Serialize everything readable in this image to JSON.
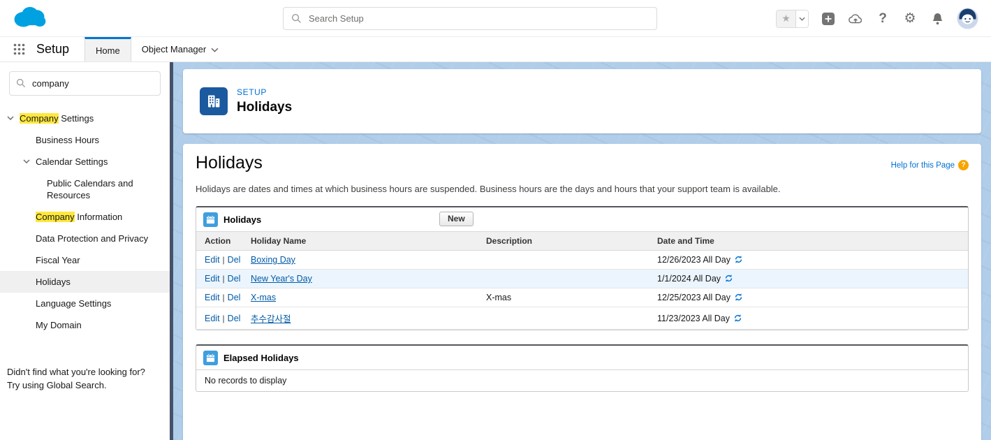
{
  "colors": {
    "brand_blue": "#00a1e0",
    "accent_blue": "#0176d3",
    "link_blue": "#015ba7",
    "content_background": "#b0cde9",
    "search_highlight": "#ffe83d",
    "setup_icon_blue": "#1b5a9e",
    "list_icon_blue": "#3f9ede",
    "help_icon_orange": "#f7a400"
  },
  "header": {
    "search": {
      "placeholder": "Search Setup"
    },
    "icons": [
      "favorites-star",
      "favorites-dropdown",
      "global-actions-plus",
      "upload-cloud",
      "help-question",
      "setup-gear",
      "notifications-bell",
      "user-avatar"
    ]
  },
  "nav": {
    "app_label": "Setup",
    "tabs": [
      {
        "label": "Home"
      },
      {
        "label": "Object Manager"
      }
    ]
  },
  "sidebar": {
    "search_value": "company",
    "items": [
      {
        "hl": "Company",
        "label": " Settings"
      },
      {
        "hl": "",
        "label": "Business Hours"
      },
      {
        "hl": "",
        "label": "Calendar Settings"
      },
      {
        "hl": "",
        "label": "Public Calendars and Resources"
      },
      {
        "hl": "Company",
        "label": " Information"
      },
      {
        "hl": "",
        "label": "Data Protection and Privacy"
      },
      {
        "hl": "",
        "label": "Fiscal Year"
      },
      {
        "hl": "",
        "label": "Holidays"
      },
      {
        "hl": "",
        "label": "Language Settings"
      },
      {
        "hl": "",
        "label": "My Domain"
      }
    ],
    "footer_line1": "Didn't find what you're looking for?",
    "footer_line2": "Try using Global Search."
  },
  "page_header": {
    "eyebrow": "SETUP",
    "title": "Holidays"
  },
  "main": {
    "title": "Holidays",
    "help_link": "Help for this Page",
    "intro": "Holidays are dates and times at which business hours are suspended. Business hours are the days and hours that your support team is available.",
    "holidays": {
      "title": "Holidays",
      "new_button": "New",
      "columns": [
        "Action",
        "Holiday Name",
        "Description",
        "Date and Time"
      ],
      "action_edit": "Edit",
      "action_del": "Del",
      "action_sep": "|",
      "rows": [
        {
          "name": "Boxing Day",
          "description": "",
          "date": "12/26/2023 All Day"
        },
        {
          "name": "New Year's Day",
          "description": "",
          "date": "1/1/2024 All Day"
        },
        {
          "name": "X-mas",
          "description": "X-mas",
          "date": "12/25/2023 All Day"
        },
        {
          "name": "추수감사절",
          "description": "",
          "date": "11/23/2023 All Day"
        }
      ]
    },
    "elapsed": {
      "title": "Elapsed Holidays",
      "empty_message": "No records to display"
    }
  }
}
